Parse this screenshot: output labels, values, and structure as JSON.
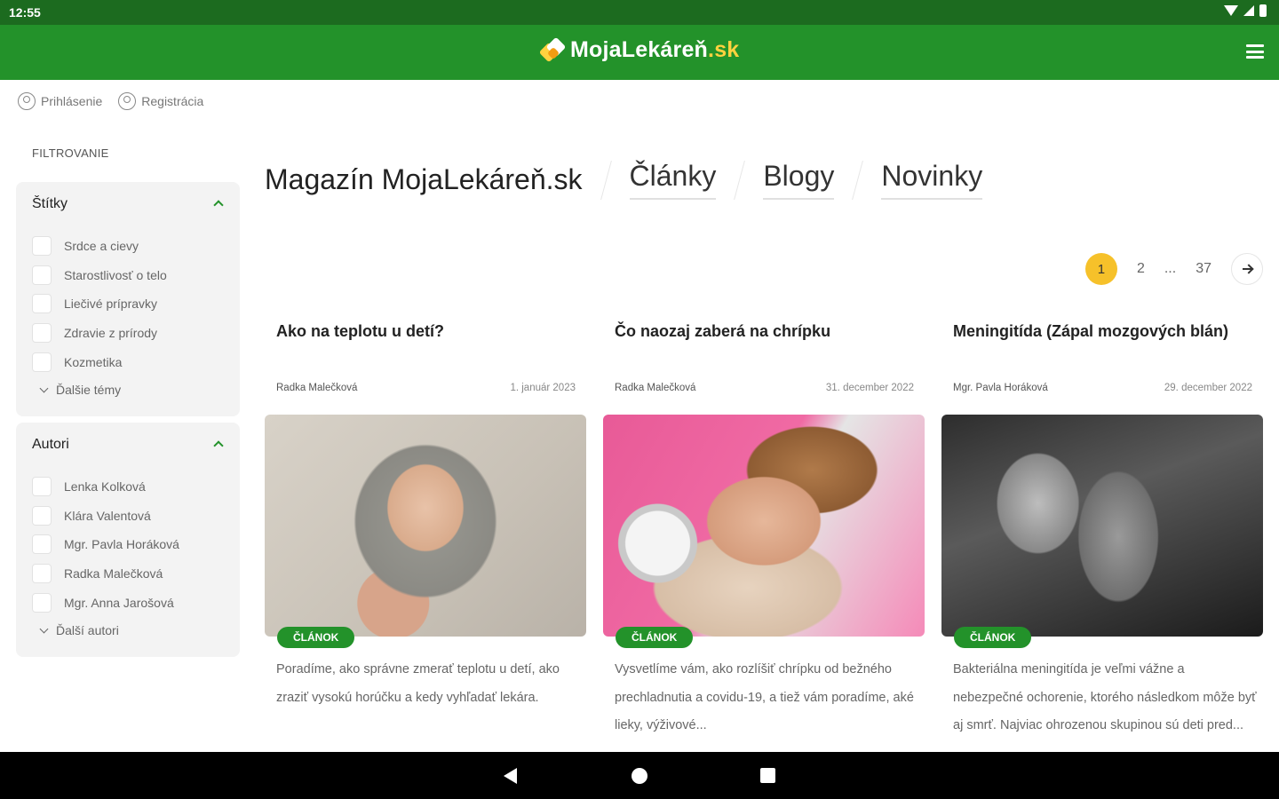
{
  "status_bar": {
    "time": "12:55"
  },
  "header": {
    "logo_main": "MojaLekáreň",
    "logo_suffix": ".sk"
  },
  "account": {
    "login": "Prihlásenie",
    "register": "Registrácia"
  },
  "sidebar": {
    "filter_title": "FILTROVANIE",
    "tags": {
      "title": "Štítky",
      "items": [
        "Srdce a cievy",
        "Starostlivosť o telo",
        "Liečivé prípravky",
        "Zdravie z prírody",
        "Kozmetika"
      ],
      "more": "Ďalšie témy"
    },
    "authors": {
      "title": "Autori",
      "items": [
        "Lenka Kolková",
        "Klára Valentová",
        "Mgr. Pavla Horáková",
        "Radka Malečková",
        "Mgr. Anna Jarošová"
      ],
      "more": "Ďalší autori"
    }
  },
  "tabs": {
    "home": "Magazín MojaLekáreň.sk",
    "articles": "Články",
    "blogs": "Blogy",
    "news": "Novinky"
  },
  "pagination": {
    "current": "1",
    "next_page": "2",
    "ellipsis": "...",
    "last": "37"
  },
  "articles": [
    {
      "title": "Ako na teplotu u detí?",
      "author": "Radka Malečková",
      "date": "1. január 2023",
      "badge": "ČLÁNOK",
      "excerpt": "Poradíme, ako správne zmerať teplotu u detí, ako zraziť vysokú horúčku a kedy vyhľadať lekára."
    },
    {
      "title": "Čo naozaj zaberá na chrípku",
      "author": "Radka Malečková",
      "date": "31. december 2022",
      "badge": "ČLÁNOK",
      "excerpt": "Vysvetlíme vám, ako rozlíšiť chrípku od bežného prechladnutia a covidu-19, a tiež vám poradíme, aké lieky, výživové..."
    },
    {
      "title": "Meningitída (Zápal mozgových blán)",
      "author": "Mgr. Pavla Horáková",
      "date": "29. december 2022",
      "badge": "ČLÁNOK",
      "excerpt": "Bakteriálna meningitída je veľmi vážne a nebezpečné ochorenie, ktorého následkom môže byť aj smrť. Najviac ohrozenou skupinou sú deti pred..."
    }
  ]
}
